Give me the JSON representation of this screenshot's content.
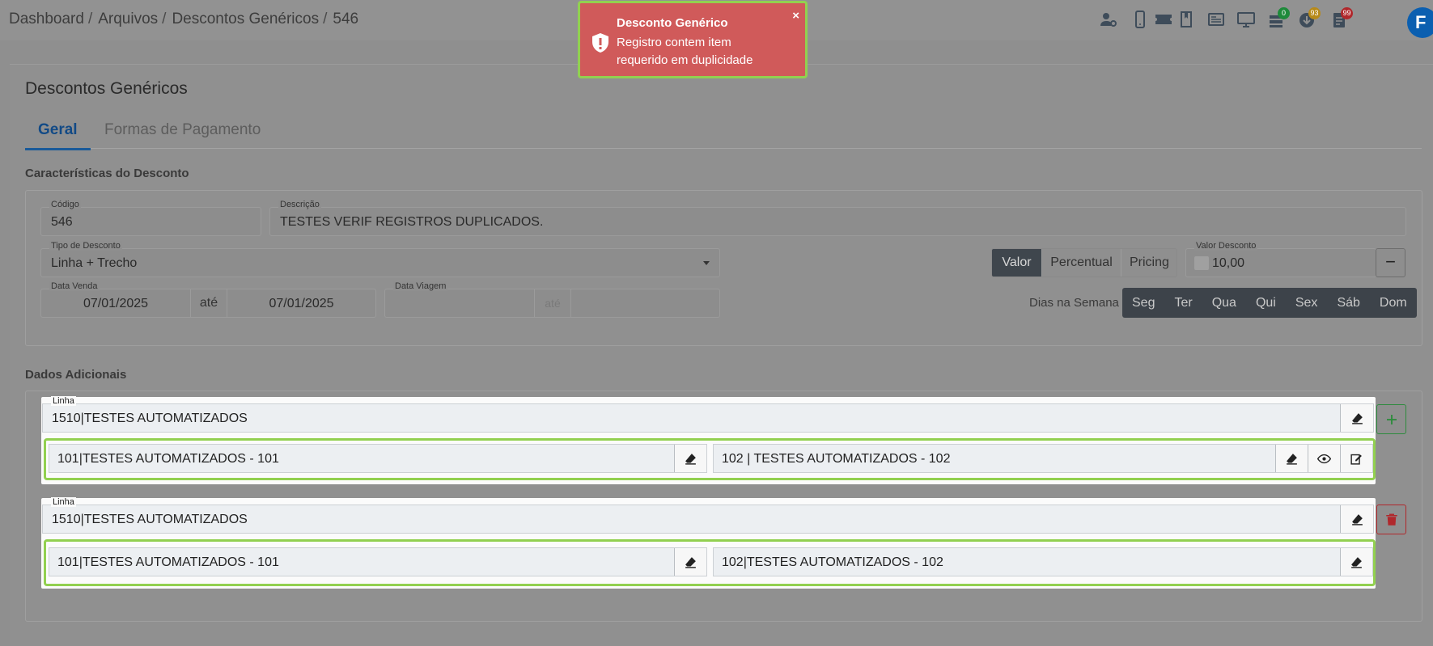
{
  "breadcrumb": [
    "Dashboard",
    "Arquivos",
    "Descontos Genéricos",
    "546"
  ],
  "header_icons": [
    {
      "name": "user-gear-icon"
    },
    {
      "name": "mobile-icon"
    },
    {
      "name": "ticket-icon"
    },
    {
      "name": "book-icon"
    },
    {
      "name": "newspaper-icon"
    },
    {
      "name": "monitor-icon"
    },
    {
      "name": "stack-icon",
      "badge": "0",
      "badge_color": "#1e8a3a"
    },
    {
      "name": "download-icon",
      "badge": "93",
      "badge_color": "#b78a1a"
    },
    {
      "name": "document-icon",
      "badge": "99",
      "badge_color": "#b0282c"
    }
  ],
  "avatar": "F",
  "toast": {
    "title": "Desconto Genérico",
    "message": "Registro contem item requerido em duplicidade",
    "close": "×",
    "color": "#d05a5a"
  },
  "page": {
    "title": "Descontos Genéricos",
    "tabs": [
      "Geral",
      "Formas de Pagamento"
    ]
  },
  "caracteristicas": {
    "title": "Características do Desconto",
    "codigo": {
      "label": "Código",
      "value": "546"
    },
    "descricao": {
      "label": "Descrição",
      "value": "TESTES VERIF REGISTROS DUPLICADOS."
    },
    "tipo": {
      "label": "Tipo de Desconto",
      "value": "Linha + Trecho"
    },
    "modo": {
      "options": [
        "Valor",
        "Percentual",
        "Pricing"
      ],
      "selected": "Valor"
    },
    "valor_desconto": {
      "label": "Valor Desconto",
      "value": "10,00",
      "button": "−"
    },
    "data_venda": {
      "label": "Data Venda",
      "from": "07/01/2025",
      "ate": "até",
      "to": "07/01/2025"
    },
    "data_viagem": {
      "label": "Data Viagem",
      "from": "",
      "ate": "até",
      "to": ""
    },
    "dias_label": "Dias na Semana",
    "dias": [
      "Seg",
      "Ter",
      "Qua",
      "Qui",
      "Sex",
      "Sáb",
      "Dom"
    ]
  },
  "dados": {
    "title": "Dados Adicionais",
    "linhas": [
      {
        "label": "Linha",
        "value": "1510|TESTES AUTOMATIZADOS",
        "trecho_origem": "101|TESTES AUTOMATIZADOS - 101",
        "trecho_destino": "102 | TESTES AUTOMATIZADOS - 102",
        "action": "add"
      },
      {
        "label": "Linha",
        "value": "1510|TESTES AUTOMATIZADOS",
        "trecho_origem": "101|TESTES AUTOMATIZADOS - 101",
        "trecho_destino": "102|TESTES AUTOMATIZADOS - 102",
        "action": "delete"
      }
    ]
  },
  "colors": {
    "highlight": "#92d050",
    "add_button": "#2e8b3e",
    "delete_button": "#b0282c",
    "tab_active": "#124a86"
  }
}
